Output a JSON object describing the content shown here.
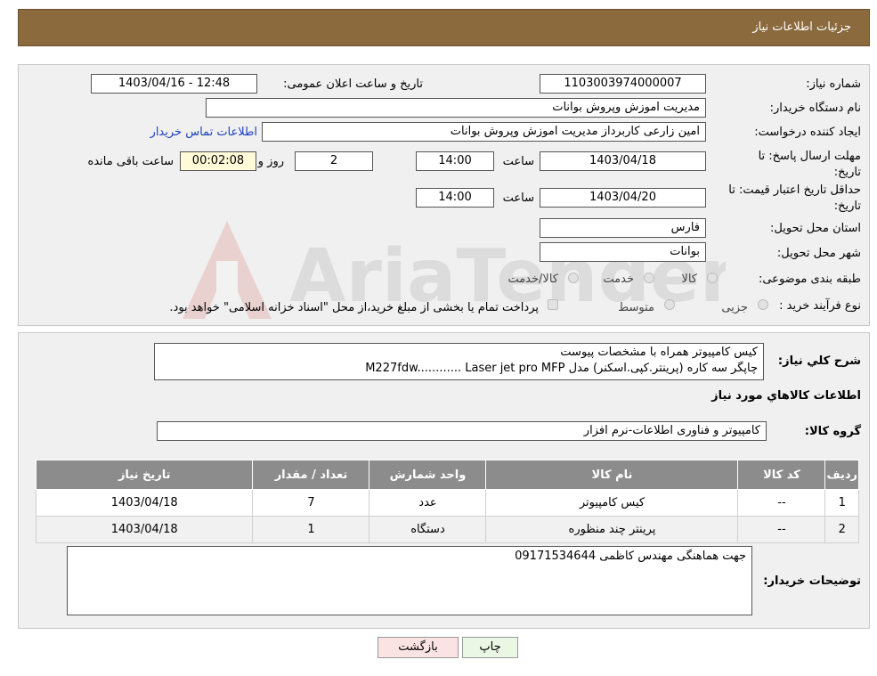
{
  "header": {
    "title": "جزئیات اطلاعات نیاز"
  },
  "form": {
    "need_number_label": "شماره نیاز:",
    "need_number": "1103003974000007",
    "announce_label": "تاریخ و ساعت اعلان عمومی:",
    "announce_value": "1403/04/16 - 12:48",
    "buyer_org_label": "نام دستگاه خریدار:",
    "buyer_org": "مدیریت اموزش وپروش بوانات",
    "requester_label": "ایجاد کننده درخواست:",
    "requester": "امین زارعی کاربرداز مدیریت اموزش وپروش بوانات",
    "contact_link": "اطلاعات تماس خریدار",
    "deadline_label_1": "مهلت ارسال پاسخ: تا",
    "deadline_label_2": "تاریخ:",
    "deadline_date": "1403/04/18",
    "time_label": "ساعت",
    "deadline_time": "14:00",
    "days_value": "2",
    "days_label": "روز و",
    "remaining_value": "00:02:08",
    "remaining_label": "ساعت باقی مانده",
    "validity_label_1": "حداقل تاریخ اعتبار قیمت: تا",
    "validity_label_2": "تاریخ:",
    "validity_date": "1403/04/20",
    "validity_time": "14:00",
    "province_label": "استان محل تحویل:",
    "province": "فارس",
    "city_label": "شهر محل تحویل:",
    "city": "بوانات",
    "category_label": "طبقه بندی موضوعی:",
    "category_options": [
      "کالا",
      "خدمت",
      "کالا/خدمت"
    ],
    "process_label": "نوع فرآیند خرید :",
    "process_options": [
      "جزیی",
      "متوسط"
    ],
    "process_note": "پرداخت تمام یا بخشی از مبلغ خرید،از محل \"اسناد خزانه اسلامی\" خواهد بود."
  },
  "summary": {
    "label": "شرح کلي نیاز:",
    "line1": "کیس کامپیوتر همراه با مشخصات پیوست",
    "line2": "چاپگر سه کاره (پرینتر.کپی.اسکنر) مدل M227fdw............    Laser jet pro MFP"
  },
  "goods": {
    "section_title": "اطلاعات کالاهاي مورد نیاز",
    "group_label": "گروه کالا:",
    "group_value": "کامپیوتر و فناوری اطلاعات-نرم افزار",
    "columns": [
      "ردیف",
      "کد کالا",
      "نام کالا",
      "واحد شمارش",
      "تعداد / مقدار",
      "تاریخ نیاز"
    ],
    "rows": [
      [
        "1",
        "--",
        "کیس کامپیوتر",
        "عدد",
        "7",
        "1403/04/18"
      ],
      [
        "2",
        "--",
        "پرینتر چند منظوره",
        "دستگاه",
        "1",
        "1403/04/18"
      ]
    ]
  },
  "notes": {
    "label": "توضیحات خریدار:",
    "value": "جهت هماهنگی مهندس کاظمی 09171534644"
  },
  "buttons": {
    "print": "چاپ",
    "back": "بازگشت"
  },
  "watermark": {
    "text": "AriaTender.neT"
  }
}
